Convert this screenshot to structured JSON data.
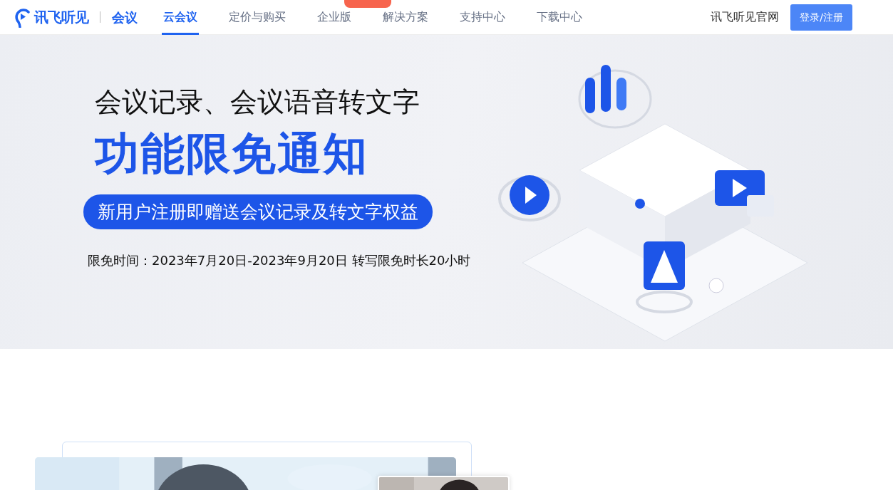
{
  "header": {
    "brand": "讯飞听见",
    "product": "会议",
    "nav": [
      {
        "label": "云会议",
        "selected": true,
        "badge": false
      },
      {
        "label": "定价与购买",
        "selected": false,
        "badge": false
      },
      {
        "label": "企业版",
        "selected": false,
        "badge": true
      },
      {
        "label": "解决方案",
        "selected": false,
        "badge": false
      },
      {
        "label": "支持中心",
        "selected": false,
        "badge": false
      },
      {
        "label": "下载中心",
        "selected": false,
        "badge": false
      }
    ],
    "official_site": "讯飞听见官网",
    "login_button": "登录/注册"
  },
  "banner": {
    "headline": "会议记录、会议语音转文字",
    "title": "功能限免通知",
    "pill": "新用户注册即赠送会议记录及转文字权益",
    "period": "限免时间：2023年7月20日-2023年9月20日 转写限免时长20小时"
  }
}
